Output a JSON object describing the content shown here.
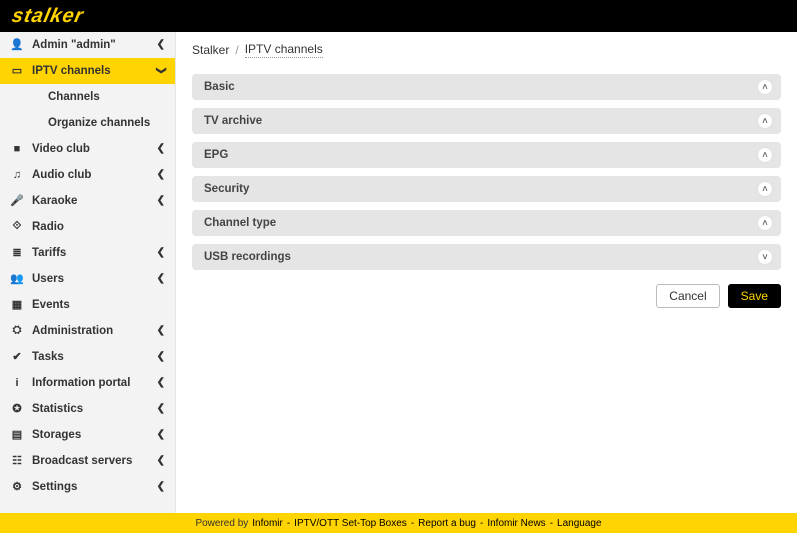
{
  "brand": "stalker",
  "breadcrumb": {
    "root": "Stalker",
    "current": "IPTV channels"
  },
  "sidebar": {
    "admin_label": "Admin \"admin\"",
    "items": [
      {
        "icon": "▭",
        "label": "IPTV channels",
        "active": true,
        "open": true,
        "children": [
          {
            "label": "Channels"
          },
          {
            "label": "Organize channels"
          }
        ]
      },
      {
        "icon": "■",
        "label": "Video club",
        "caret": true
      },
      {
        "icon": "♫",
        "label": "Audio club",
        "caret": true
      },
      {
        "icon": "🎤",
        "label": "Karaoke",
        "caret": true
      },
      {
        "icon": "⟐",
        "label": "Radio",
        "caret": false
      },
      {
        "icon": "≣",
        "label": "Tariffs",
        "caret": true
      },
      {
        "icon": "👥",
        "label": "Users",
        "caret": true
      },
      {
        "icon": "▦",
        "label": "Events",
        "caret": false
      },
      {
        "icon": "⛭",
        "label": "Administration",
        "caret": true
      },
      {
        "icon": "✔",
        "label": "Tasks",
        "caret": true
      },
      {
        "icon": "i",
        "label": "Information portal",
        "caret": true
      },
      {
        "icon": "✪",
        "label": "Statistics",
        "caret": true
      },
      {
        "icon": "▤",
        "label": "Storages",
        "caret": true
      },
      {
        "icon": "☷",
        "label": "Broadcast servers",
        "caret": true
      },
      {
        "icon": "⚙",
        "label": "Settings",
        "caret": true
      }
    ]
  },
  "accordion": [
    {
      "label": "Basic",
      "state": "up"
    },
    {
      "label": "TV archive",
      "state": "up"
    },
    {
      "label": "EPG",
      "state": "up"
    },
    {
      "label": "Security",
      "state": "up"
    },
    {
      "label": "Channel type",
      "state": "up"
    },
    {
      "label": "USB recordings",
      "state": "down"
    }
  ],
  "buttons": {
    "cancel": "Cancel",
    "save": "Save"
  },
  "footer": {
    "powered_prefix": "Powered by ",
    "infomir": "Infomir",
    "iptvott": "IPTV/OTT Set-Top Boxes",
    "report": "Report a bug",
    "news": "Infomir News",
    "language": "Language"
  }
}
